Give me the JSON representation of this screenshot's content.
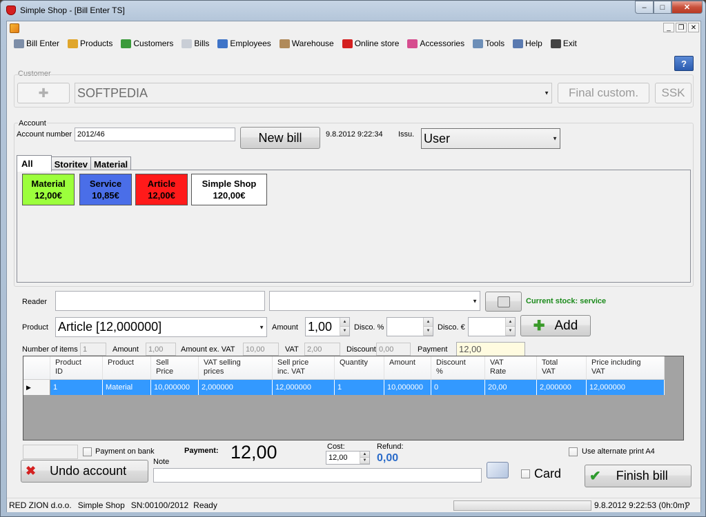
{
  "window": {
    "title": "Simple Shop - [Bill Enter TS]",
    "min": "–",
    "max": "□",
    "close": "✕"
  },
  "mdi": {
    "min": "_",
    "restore": "❐",
    "close": "✕"
  },
  "menu": [
    {
      "label": "Bill Enter",
      "icon": "bill-enter-icon",
      "color": "#7d8ea8"
    },
    {
      "label": "Products",
      "icon": "products-icon",
      "color": "#e0a62b"
    },
    {
      "label": "Customers",
      "icon": "customers-icon",
      "color": "#3a9a3a"
    },
    {
      "label": "Bills",
      "icon": "bills-icon",
      "color": "#c9ced6"
    },
    {
      "label": "Employees",
      "icon": "employees-icon",
      "color": "#3f74c8"
    },
    {
      "label": "Warehouse",
      "icon": "warehouse-icon",
      "color": "#b08a5a"
    },
    {
      "label": "Online store",
      "icon": "cart-icon",
      "color": "#d42020"
    },
    {
      "label": "Accessories",
      "icon": "accessories-icon",
      "color": "#d64d8f"
    },
    {
      "label": "Tools",
      "icon": "tools-icon",
      "color": "#6d8fb8"
    },
    {
      "label": "Help",
      "icon": "help-doc-icon",
      "color": "#5a7ab0"
    },
    {
      "label": "Exit",
      "icon": "power-icon",
      "color": "#444444"
    }
  ],
  "help_button": "?",
  "customer": {
    "group_label": "Customer",
    "add_symbol": "✚",
    "name": "SOFTPEDIA",
    "final_button": "Final custom.",
    "ssk_button": "SSK"
  },
  "account": {
    "group_label": "Account",
    "number_label": "Account number",
    "number_value": "2012/46",
    "new_bill_button": "New bill",
    "datetime": "9.8.2012 9:22:34",
    "issuer_label": "Issu.",
    "issuer_value": "User"
  },
  "tabs": [
    "All",
    "Storitev",
    "Material"
  ],
  "tiles": [
    {
      "name": "Material",
      "price": "12,00€",
      "color": "#9cff3c"
    },
    {
      "name": "Service",
      "price": "10,85€",
      "color": "#4a6ee8"
    },
    {
      "name": "Article",
      "price": "12,00€",
      "color": "#ff1a1a"
    },
    {
      "name": "Simple Shop",
      "price": "120,00€",
      "color": "#ffffff"
    }
  ],
  "entry": {
    "reader_label": "Reader",
    "reader_value": "",
    "stock_text": "Current stock: service",
    "product_label": "Product",
    "product_value": "Article [12,000000]",
    "amount_label": "Amount",
    "amount_value": "1,00",
    "disc_pct_label": "Disco. %",
    "disc_eur_label": "Disco. €",
    "add_button": "Add"
  },
  "summary": {
    "items_label": "Number of items",
    "items_value": "1",
    "amount_label": "Amount",
    "amount_value": "1,00",
    "ex_vat_label": "Amount ex. VAT",
    "ex_vat_value": "10,00",
    "vat_label": "VAT",
    "vat_value": "2,00",
    "discount_label": "Discount",
    "discount_value": "0,00",
    "payment_label": "Payment",
    "payment_value": "12,00"
  },
  "grid": {
    "columns": [
      "Product\nID",
      "Product",
      "Sell\nPrice",
      "VAT selling\nprices",
      "Sell price\ninc. VAT",
      "Quantity",
      "Amount",
      "Discount\n%",
      "VAT\nRate",
      "Total\nVAT",
      "Price including\nVAT"
    ],
    "rows": [
      [
        "1",
        "Material",
        "10,000000",
        "2,000000",
        "12,000000",
        "1",
        "10,000000",
        "0",
        "20,00",
        "2,000000",
        "12,000000"
      ]
    ]
  },
  "footer": {
    "bank_label": "Payment on bank",
    "payment_label": "Payment:",
    "payment_value": "12,00",
    "cost_label": "Cost:",
    "cost_value": "12,00",
    "refund_label": "Refund:",
    "refund_value": "0,00",
    "alt_print_label": "Use alternate print A4",
    "undo_button": "Undo account",
    "note_label": "Note",
    "card_label": "Card",
    "finish_button": "Finish bill"
  },
  "status": {
    "company": "RED ZION d.o.o.",
    "app": "Simple Shop",
    "serial": "SN:00100/2012",
    "state": "Ready",
    "clock": "9.8.2012 9:22:53 (0h:0m)",
    "help": "?"
  }
}
